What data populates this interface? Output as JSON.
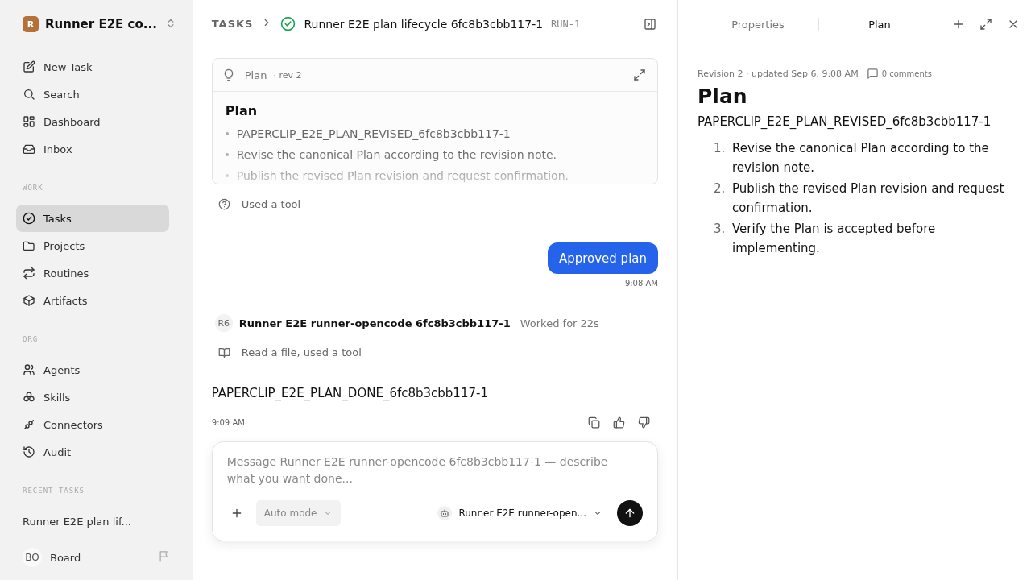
{
  "workspace": {
    "initial": "R",
    "name": "Runner E2E co..."
  },
  "nav": [
    {
      "label": "New Task",
      "selected": false
    },
    {
      "label": "Search",
      "selected": false
    },
    {
      "label": "Dashboard",
      "selected": false
    },
    {
      "label": "Inbox",
      "selected": false
    }
  ],
  "sections": [
    {
      "title": "WORK",
      "items": [
        {
          "label": "Tasks",
          "selected": true
        },
        {
          "label": "Projects",
          "selected": false
        },
        {
          "label": "Routines",
          "selected": false
        },
        {
          "label": "Artifacts",
          "selected": false
        }
      ]
    },
    {
      "title": "ORG",
      "items": [
        {
          "label": "Agents",
          "selected": false
        },
        {
          "label": "Skills",
          "selected": false
        },
        {
          "label": "Connectors",
          "selected": false
        },
        {
          "label": "Audit",
          "selected": false
        }
      ]
    }
  ],
  "recent": {
    "title": "RECENT TASKS",
    "items": [
      "Runner E2E plan lif..."
    ]
  },
  "user": {
    "initials": "BO",
    "name": "Board"
  },
  "header": {
    "breadcrumb": "TASKS",
    "title": "Runner E2E plan lifecycle 6fc8b3cbb117-1",
    "id": "RUN-1"
  },
  "plan_card": {
    "label": "Plan",
    "revision": "· rev 2",
    "heading": "Plan",
    "items": [
      "PAPERCLIP_E2E_PLAN_REVISED_6fc8b3cbb117-1",
      "Revise the canonical Plan according to the revision note.",
      "Publish the revised Plan revision and request confirmation."
    ]
  },
  "tool_note": "Used a tool",
  "user_message": {
    "text": "Approved plan",
    "time": "9:08 AM"
  },
  "agent": {
    "initials": "R6",
    "name": "Runner E2E runner-opencode 6fc8b3cbb117-1",
    "duration": "Worked for 22s",
    "activity": "Read a file, used a tool",
    "reply": "PAPERCLIP_E2E_PLAN_DONE_6fc8b3cbb117-1",
    "time": "9:09 AM"
  },
  "composer": {
    "placeholder": "Message Runner E2E runner-opencode 6fc8b3cbb117-1 — describe what you want done...",
    "mode": "Auto mode",
    "agent": "Runner E2E runner-open..."
  },
  "panel": {
    "tabs": [
      {
        "label": "Properties",
        "selected": false
      },
      {
        "label": "Plan",
        "selected": true
      }
    ],
    "meta": "Revision 2 · updated Sep 6, 9:08 AM",
    "comments": "0 comments",
    "title": "Plan",
    "code": "PAPERCLIP_E2E_PLAN_REVISED_6fc8b3cbb117-1",
    "steps": [
      {
        "number": "1.",
        "text": "Revise the canonical Plan according to the revision note."
      },
      {
        "number": "2.",
        "text": "Publish the revised Plan revision and request confirmation."
      },
      {
        "number": "3.",
        "text": "Verify the Plan is accepted before implementing."
      }
    ]
  }
}
